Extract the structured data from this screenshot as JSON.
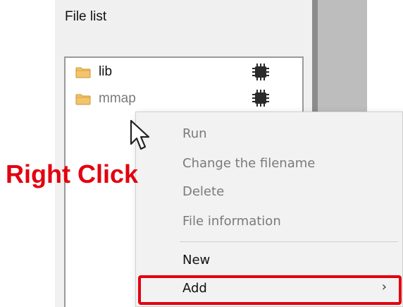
{
  "panel": {
    "title": "File list"
  },
  "files": [
    {
      "name": "lib",
      "icon": "folder-icon",
      "status_icon": "chip-icon"
    },
    {
      "name": "mmap",
      "icon": "folder-icon",
      "status_icon": "chip-icon"
    }
  ],
  "context_menu": {
    "items": [
      {
        "label": "Run",
        "enabled": false
      },
      {
        "label": "Change the filename",
        "enabled": false
      },
      {
        "label": "Delete",
        "enabled": false
      },
      {
        "label": "File information",
        "enabled": false
      },
      {
        "label": "New",
        "enabled": true
      },
      {
        "label": "Add",
        "enabled": true,
        "submenu_glyph": "›"
      }
    ]
  },
  "annotation": {
    "label": "Right Click",
    "color": "#e3000f"
  },
  "colors": {
    "folder": "#f0c060",
    "accent_red": "#e3000f",
    "disabled_text": "#7a7a7a"
  }
}
